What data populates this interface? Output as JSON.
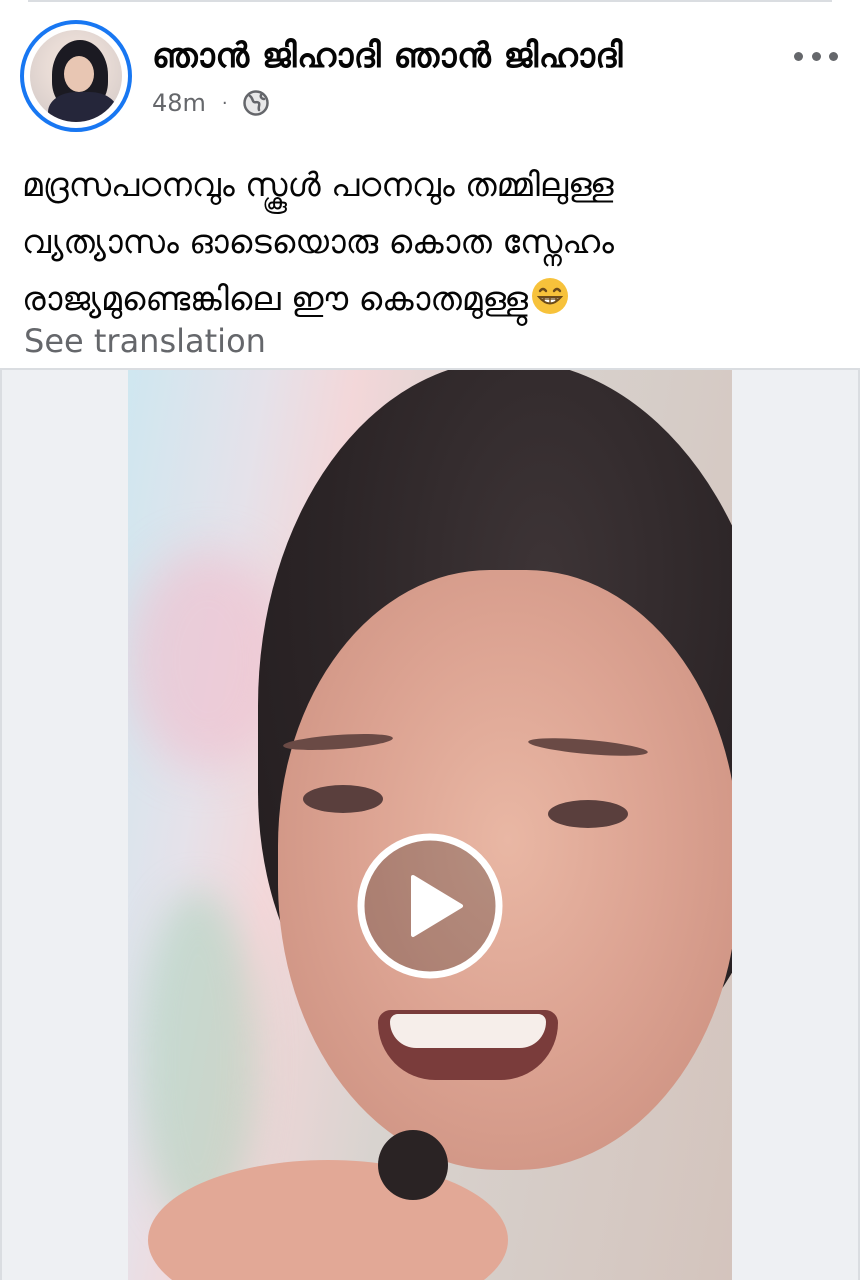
{
  "post": {
    "author_name": "ഞാൻ ജിഹാദി ഞാൻ ജിഹാദി",
    "timestamp": "48m",
    "separator": "·",
    "privacy_icon": "globe-icon",
    "more_icon": "more-horizontal-icon",
    "text_lines": [
      "മദ്രസപഠനവും സ്കൂൾ പഠനവും തമ്മിലുള്ള",
      "വ്യത്യാസം ഓടെയൊരു കൊത സ്നേഹം",
      "രാജ്യമുണ്ടെങ്കിലെ ഈ കൊതമുള്ളു"
    ],
    "text_emoji": "grinning-face-with-smiling-eyes",
    "see_translation": "See translation"
  },
  "video": {
    "play_icon": "play-icon",
    "accent_color": "#1877f2"
  }
}
